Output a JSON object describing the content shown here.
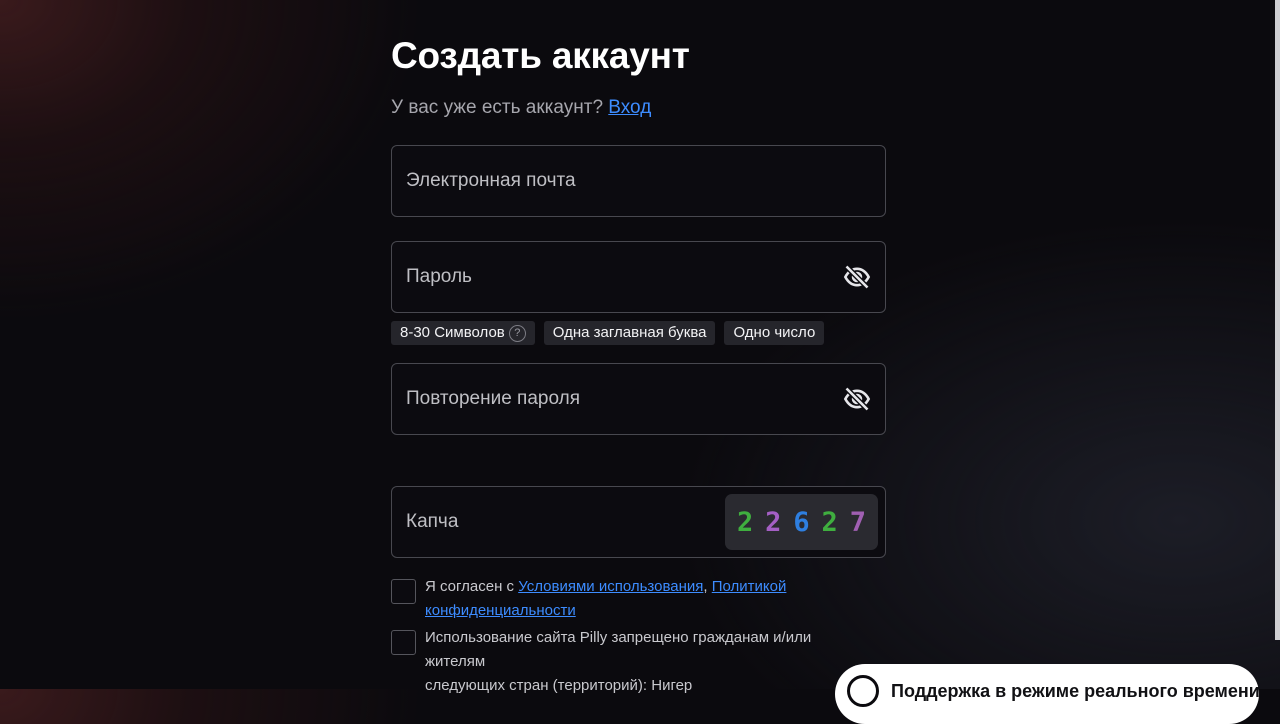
{
  "title": "Создать аккаунт",
  "login_prompt": {
    "text": "У вас уже есть аккаунт?",
    "link": "Вход"
  },
  "fields": {
    "email_placeholder": "Электронная почта",
    "password_placeholder": "Пароль",
    "repeat_password_placeholder": "Повторение пароля",
    "captcha_placeholder": "Капча"
  },
  "password_hints": [
    {
      "label": "8-30 Символов",
      "help": "?"
    },
    {
      "label": "Одна заглавная буква"
    },
    {
      "label": "Одно число"
    }
  ],
  "captcha": {
    "digits": [
      {
        "char": "2",
        "color": "#3fae3f"
      },
      {
        "char": "2",
        "color": "#a45fc4"
      },
      {
        "char": "6",
        "color": "#2e7fe0"
      },
      {
        "char": "2",
        "color": "#3fae3f"
      },
      {
        "char": "7",
        "color": "#a05fb2"
      }
    ]
  },
  "agreements": {
    "terms_prefix": "Я согласен с ",
    "terms_link": "Условиями использования",
    "terms_sep": ", ",
    "privacy_link_1": "Политикой",
    "privacy_link_2": "конфиденциальности",
    "restriction_line_1": "Использование сайта Pilly запрещено гражданам и/или жителям",
    "restriction_line_2": "следующих стран (территорий): Нигер"
  },
  "support_widget": {
    "text": "Поддержка в режиме реального времени"
  },
  "colors": {
    "link": "#3d8cff",
    "background": "#0b0a0e",
    "field_border": "#48484f"
  }
}
